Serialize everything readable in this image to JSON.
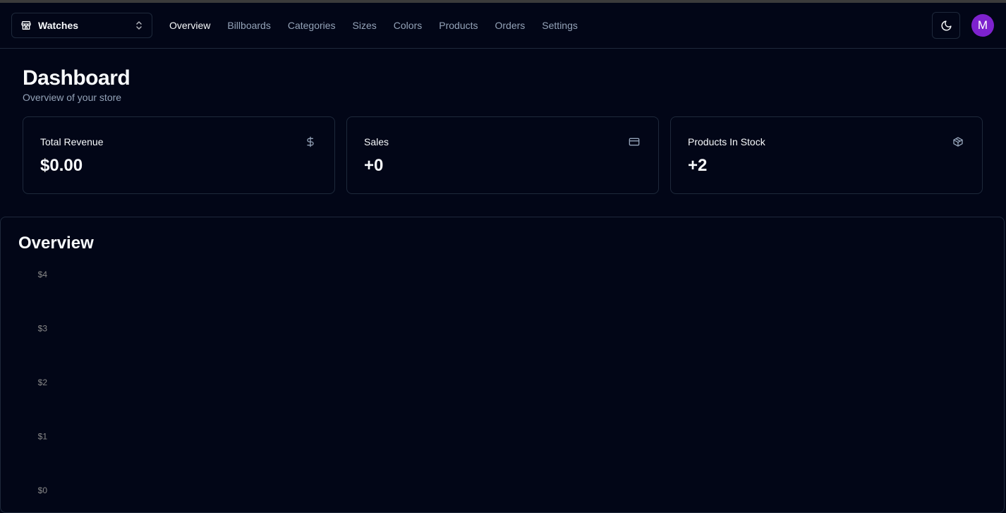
{
  "store_switcher": {
    "name": "Watches"
  },
  "nav": {
    "links": [
      "Overview",
      "Billboards",
      "Categories",
      "Sizes",
      "Colors",
      "Products",
      "Orders",
      "Settings"
    ],
    "active": "Overview"
  },
  "user": {
    "avatar_initial": "M",
    "avatar_color": "#7e22ce"
  },
  "page": {
    "title": "Dashboard",
    "subtitle": "Overview of your store"
  },
  "cards": [
    {
      "title": "Total Revenue",
      "value": "$0.00",
      "icon": "dollar-sign-icon"
    },
    {
      "title": "Sales",
      "value": "+0",
      "icon": "credit-card-icon"
    },
    {
      "title": "Products In Stock",
      "value": "+2",
      "icon": "package-icon"
    }
  ],
  "overview": {
    "title": "Overview"
  },
  "chart_data": {
    "type": "bar",
    "title": "",
    "categories": [],
    "values": [],
    "y_ticks": [
      "$4",
      "$3",
      "$2",
      "$1",
      "$0"
    ],
    "ylim": [
      0,
      4
    ],
    "grid": false
  },
  "colors": {
    "background": "#020617",
    "border": "#1e293b",
    "muted_text": "#94a3b8",
    "foreground": "#f8fafc"
  }
}
